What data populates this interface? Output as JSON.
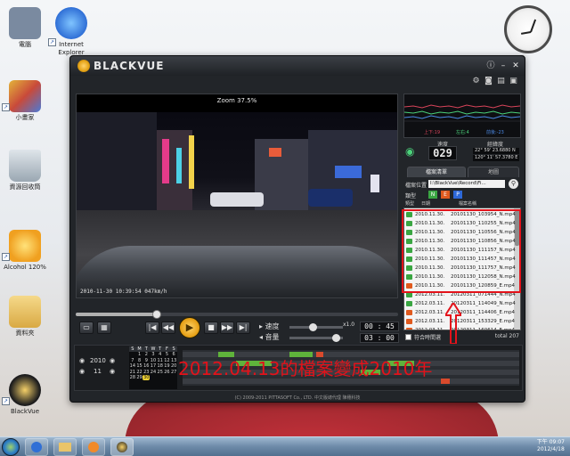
{
  "desktop": {
    "icons": [
      {
        "label": "電腦",
        "color": "#7a8aa0"
      },
      {
        "label": "Internet Explorer",
        "color": "#2f6fd6"
      },
      {
        "label": "小畫家",
        "color": "#e3b43a"
      },
      {
        "label": "資源回收筒",
        "color": "#9aa7b2"
      },
      {
        "label": "Alcohol 120%",
        "color": "#f0c020"
      },
      {
        "label": "資料夾",
        "color": "#e9c46a"
      },
      {
        "label": "BlackVue",
        "color": "#1e1e1e"
      }
    ]
  },
  "window": {
    "brand": "BLACKVUE",
    "zoom_label": "Zoom 37.5%",
    "osd": "2010-11-30  10:39:54  047km/h",
    "time_current": "00 : 45",
    "time_total": "03 : 00",
    "speed_label": "x1.0",
    "label_speed": "速度",
    "label_volume": "音量"
  },
  "gps": {
    "label_speed": "速度",
    "label_coords": "經緯度",
    "speed_value": "029",
    "lat": "22° 59' 23.6880 N",
    "lon": "120° 11' 57.3780 E",
    "graph_labels": [
      "上下:19",
      "左右:4",
      "前後:-23"
    ]
  },
  "panel": {
    "tab_files": "檔案清單",
    "tab_map": "地圖",
    "path_label": "檔案位置",
    "path_value": "I:\\BlackVue\\Record\\Fi...",
    "type_label": "類型",
    "types": [
      {
        "label": "N",
        "color": "#3aa642"
      },
      {
        "label": "E",
        "color": "#e05a1e"
      },
      {
        "label": "P",
        "color": "#2d68d8"
      }
    ],
    "head_type": "類型",
    "head_date": "日期",
    "head_name": "檔案名稱",
    "bottom_checkbox": "符合時間選",
    "total": "total 207"
  },
  "files": [
    {
      "date": "2010.11.30.",
      "name": "20101130_103954_N.mp4",
      "icon": "#3aa642"
    },
    {
      "date": "2010.11.30.",
      "name": "20101130_110255_N.mp4",
      "icon": "#3aa642"
    },
    {
      "date": "2010.11.30.",
      "name": "20101130_110556_N.mp4",
      "icon": "#3aa642"
    },
    {
      "date": "2010.11.30.",
      "name": "20101130_110856_N.mp4",
      "icon": "#3aa642"
    },
    {
      "date": "2010.11.30.",
      "name": "20101130_111157_N.mp4",
      "icon": "#3aa642"
    },
    {
      "date": "2010.11.30.",
      "name": "20101130_111457_N.mp4",
      "icon": "#3aa642"
    },
    {
      "date": "2010.11.30.",
      "name": "20101130_111757_N.mp4",
      "icon": "#3aa642"
    },
    {
      "date": "2010.11.30.",
      "name": "20101130_112058_N.mp4",
      "icon": "#3aa642"
    },
    {
      "date": "2010.11.30.",
      "name": "20101130_120859_E.mp4",
      "icon": "#e05a1e"
    },
    {
      "date": "2012.03.11.",
      "name": "20120311_071444_N.mp4",
      "icon": "#3aa642"
    },
    {
      "date": "2012.03.11.",
      "name": "20120311_114049_N.mp4",
      "icon": "#3aa642"
    },
    {
      "date": "2012.03.11.",
      "name": "20120311_114406_E.mp4",
      "icon": "#e05a1e"
    },
    {
      "date": "2012.03.11.",
      "name": "20120311_153329_E.mp4",
      "icon": "#e05a1e"
    },
    {
      "date": "2012.03.11.",
      "name": "20120311_160614_E.mp4",
      "icon": "#e05a1e"
    }
  ],
  "calendar": {
    "year": "2010",
    "month": "11",
    "headers": [
      "S",
      "M",
      "T",
      "W",
      "T",
      "F",
      "S"
    ],
    "days": [
      "",
      "1",
      "2",
      "3",
      "4",
      "5",
      "6",
      "7",
      "8",
      "9",
      "10",
      "11",
      "12",
      "13",
      "14",
      "15",
      "16",
      "17",
      "18",
      "19",
      "20",
      "21",
      "22",
      "23",
      "24",
      "25",
      "26",
      "27",
      "28",
      "29",
      "30",
      "",
      "",
      "",
      ""
    ],
    "selected_day": "30"
  },
  "annotation": "2012.04.13的檔案變成2010年",
  "copyright": "(C) 2009-2011 PITTASOFT Co., LTD. 中文版總代理 陳穗科技",
  "tray": {
    "time": "下午 09:07",
    "date": "2012/4/18"
  }
}
